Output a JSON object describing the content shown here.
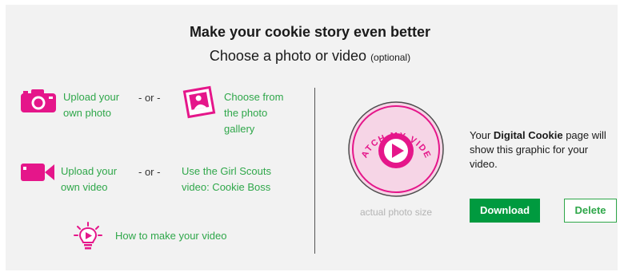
{
  "header": {
    "title": "Make your cookie story even better",
    "subtitle": "Choose a photo or video",
    "subtitle_note": "(optional)"
  },
  "photo_options": {
    "upload_icon": "camera-icon",
    "upload_line1": "Upload your",
    "upload_line2": "own photo",
    "or": "- or -",
    "gallery_icon": "photo-gallery-icon",
    "gallery_line1": "Choose from",
    "gallery_line2": "the photo",
    "gallery_line3": "gallery"
  },
  "video_options": {
    "upload_icon": "video-camera-icon",
    "upload_line1": "Upload your",
    "upload_line2": "own video",
    "or": "- or -",
    "gs_line1": "Use the Girl Scouts",
    "gs_line2": "video: Cookie Boss"
  },
  "how_to": {
    "icon": "lightbulb-play-icon",
    "label": "How to make your video"
  },
  "preview": {
    "badge_text": "WATCH MY VIDEO",
    "caption": "actual photo size",
    "info_prefix": "Your ",
    "info_bold": "Digital Cookie",
    "info_suffix": " page will show this graphic for your video."
  },
  "actions": {
    "download_label": "Download",
    "delete_label": "Delete"
  },
  "colors": {
    "accent_pink": "#e5168a",
    "link_green": "#2fa74a",
    "button_green": "#009a3f",
    "badge_fill": "#f6d5e6",
    "panel_bg": "#f2f2f2"
  }
}
